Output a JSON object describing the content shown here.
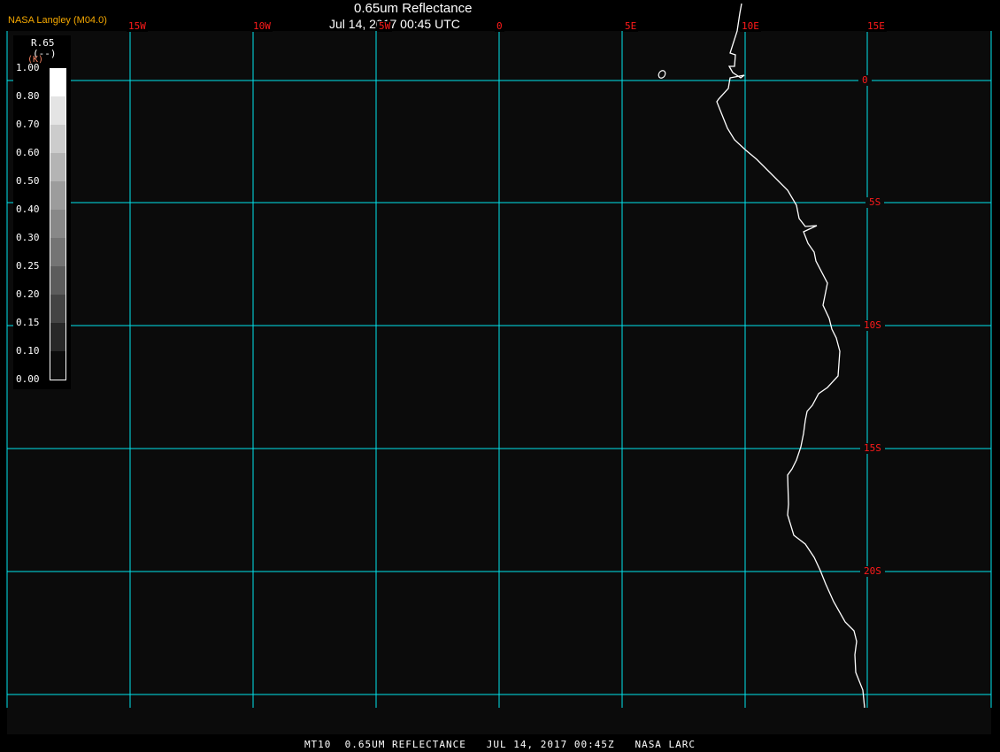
{
  "header": {
    "title": "0.65um Reflectance",
    "subtitle": "Jul 14, 2017 00:45 UTC",
    "brand": "NASA Langley (M04.0)"
  },
  "map": {
    "grid_color": "#00e5ee",
    "coast_color": "#ffffff",
    "label_color": "#ff1a1a",
    "lon_labels": [
      "15W",
      "10W",
      "5W",
      "0",
      "5E",
      "10E",
      "15E"
    ],
    "lat_labels": [
      "0",
      "5S",
      "10S",
      "15S",
      "20S"
    ]
  },
  "legend": {
    "variable": "R.65",
    "units": "(--)",
    "units_overlay": "(K)",
    "ticks": [
      "1.00",
      "0.80",
      "0.70",
      "0.60",
      "0.50",
      "0.40",
      "0.30",
      "0.25",
      "0.20",
      "0.15",
      "0.10",
      "0.00"
    ],
    "bin_colors": [
      "#ffffff",
      "#e4e4e4",
      "#cccccc",
      "#b4b4b4",
      "#9c9c9c",
      "#888888",
      "#747474",
      "#5c5c5c",
      "#444444",
      "#282828",
      "#0c0c0c"
    ]
  },
  "footer": {
    "text": "MT10  0.65UM REFLECTANCE   JUL 14, 2017 00:45Z   NASA LARC"
  }
}
